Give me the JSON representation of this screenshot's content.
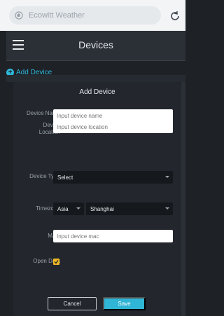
{
  "browser": {
    "site_name": "Ecowitt Weather"
  },
  "header": {
    "title": "Devices"
  },
  "page": {
    "add_device_link": "Add Device"
  },
  "modal": {
    "title": "Add Device",
    "fields": {
      "name": {
        "label": "Device Name",
        "placeholder": "Input device name"
      },
      "location": {
        "label": "Device Location",
        "placeholder": "Input device location"
      },
      "type": {
        "label": "Device Type",
        "value": "Select"
      },
      "timezone": {
        "label": "Timezone",
        "region": "Asia",
        "city": "Shanghai"
      },
      "mac": {
        "label": "MAC",
        "placeholder": "Input device mac"
      },
      "open_data": {
        "label": "Open Data",
        "checked": true
      }
    },
    "buttons": {
      "cancel": "Cancel",
      "save": "Save"
    }
  },
  "colors": {
    "accent": "#2fb5d6",
    "checkbox": "#f0b823",
    "background": "#1e2227",
    "modal": "#23272d"
  },
  "icons": {
    "browser": "globe-icon",
    "reload": "reload-icon",
    "menu": "hamburger-menu-icon",
    "add": "plus-circle-icon",
    "dropdown": "caret-down-icon",
    "check": "check-icon"
  }
}
